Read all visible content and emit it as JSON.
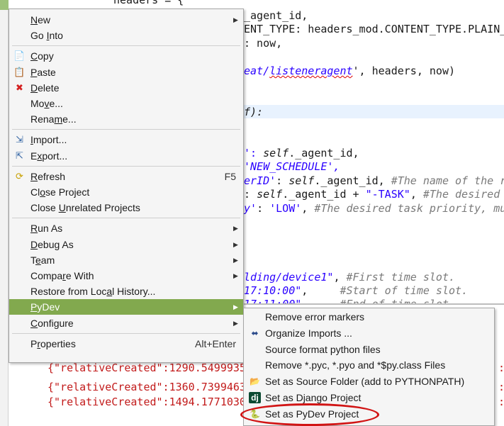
{
  "editor": {
    "top_cut": "headers = {",
    "lines": [
      {
        "parts": [
          {
            "t": "_agent_id,",
            "c": ""
          }
        ]
      },
      {
        "parts": [
          {
            "t": "ENT_TYPE: headers_mod.CONTENT_TYPE.PLAIN_",
            "c": ""
          }
        ]
      },
      {
        "parts": [
          {
            "t": ": now,",
            "c": ""
          }
        ]
      },
      {
        "parts": [
          {
            "t": "",
            "c": ""
          }
        ]
      },
      {
        "parts": [
          {
            "t": "eat/",
            "c": "str ital"
          },
          {
            "t": "listeneragent",
            "c": "str ital squig"
          },
          {
            "t": "', headers, now)",
            "c": ""
          }
        ]
      },
      {
        "parts": [
          {
            "t": "",
            "c": ""
          }
        ]
      },
      {
        "parts": [
          {
            "t": "",
            "c": ""
          }
        ]
      },
      {
        "parts": [
          {
            "t": "f):",
            "c": "ital"
          }
        ]
      },
      {
        "parts": [
          {
            "t": "",
            "c": ""
          }
        ]
      },
      {
        "parts": [
          {
            "t": "",
            "c": ""
          }
        ]
      },
      {
        "parts": [
          {
            "t": "': ",
            "c": "str"
          },
          {
            "t": "self",
            "c": "ital"
          },
          {
            "t": "._agent_id,",
            "c": ""
          }
        ]
      },
      {
        "parts": [
          {
            "t": "'NEW_SCHEDULE',",
            "c": "str ital"
          }
        ]
      },
      {
        "parts": [
          {
            "t": "erID'",
            "c": "str ital"
          },
          {
            "t": ": ",
            "c": ""
          },
          {
            "t": "self",
            "c": "ital"
          },
          {
            "t": "._agent_id, ",
            "c": ""
          },
          {
            "t": "#The name of the r",
            "c": "cmt"
          }
        ]
      },
      {
        "parts": [
          {
            "t": ": ",
            "c": ""
          },
          {
            "t": "self",
            "c": "ital"
          },
          {
            "t": "._agent_id + ",
            "c": ""
          },
          {
            "t": "\"-TASK\"",
            "c": "str"
          },
          {
            "t": ", ",
            "c": ""
          },
          {
            "t": "#The desired",
            "c": "cmt"
          }
        ]
      },
      {
        "parts": [
          {
            "t": "y'",
            "c": "str ital"
          },
          {
            "t": ": ",
            "c": ""
          },
          {
            "t": "'LOW'",
            "c": "str"
          },
          {
            "t": ", ",
            "c": ""
          },
          {
            "t": "#The desired task priority, mu",
            "c": "cmt"
          }
        ]
      },
      {
        "parts": [
          {
            "t": "",
            "c": ""
          }
        ]
      },
      {
        "parts": [
          {
            "t": "",
            "c": ""
          }
        ]
      },
      {
        "parts": [
          {
            "t": "",
            "c": ""
          }
        ]
      },
      {
        "parts": [
          {
            "t": "",
            "c": ""
          }
        ]
      },
      {
        "parts": [
          {
            "t": "lding/device1\"",
            "c": "str ital"
          },
          {
            "t": ", ",
            "c": ""
          },
          {
            "t": "#First time slot.",
            "c": "cmt"
          }
        ]
      },
      {
        "parts": [
          {
            "t": "17:10:00\"",
            "c": "str ital"
          },
          {
            "t": ",     ",
            "c": ""
          },
          {
            "t": "#Start of time slot.",
            "c": "cmt"
          }
        ]
      },
      {
        "parts": [
          {
            "t": "17:11:00\"",
            "c": "str ital"
          },
          {
            "t": ",     ",
            "c": ""
          },
          {
            "t": "#End of time slot",
            "c": "cmt"
          }
        ]
      }
    ]
  },
  "console": {
    "lines": [
      "{\"relativeCreated\":1290.54999351",
      "{\"relativeCreated\":1360.73994636",
      "{\"relativeCreated\":1494.17710304"
    ],
    "right_mark": ":"
  },
  "menu": {
    "items": [
      {
        "label": "New",
        "u": 0,
        "icon": "",
        "icon_name": "",
        "arrow": true
      },
      {
        "label": "Go Into",
        "u": 3,
        "icon": "",
        "icon_name": ""
      },
      {
        "sep": true
      },
      {
        "label": "Copy",
        "u": 0,
        "icon": "📄",
        "icon_name": "copy-icon"
      },
      {
        "label": "Paste",
        "u": 0,
        "icon": "📋",
        "icon_name": "paste-icon"
      },
      {
        "label": "Delete",
        "u": 0,
        "icon": "✖",
        "icon_name": "delete-icon",
        "icon_color": "#d42020"
      },
      {
        "label": "Move...",
        "u": 2,
        "icon": "",
        "icon_name": ""
      },
      {
        "label": "Rename...",
        "u": 4,
        "icon": "",
        "icon_name": ""
      },
      {
        "sep": true
      },
      {
        "label": "Import...",
        "u": 0,
        "icon": "⇲",
        "icon_name": "import-icon",
        "icon_color": "#3465a4"
      },
      {
        "label": "Export...",
        "u": 1,
        "icon": "⇱",
        "icon_name": "export-icon",
        "icon_color": "#3465a4"
      },
      {
        "sep": true
      },
      {
        "label": "Refresh",
        "u": 0,
        "icon": "⟳",
        "icon_name": "refresh-icon",
        "icon_color": "#c8a000",
        "acc": "F5"
      },
      {
        "label": "Close Project",
        "u": 2,
        "icon": "",
        "icon_name": ""
      },
      {
        "label": "Close Unrelated Projects",
        "u": 6,
        "icon": "",
        "icon_name": ""
      },
      {
        "sep": true
      },
      {
        "label": "Run As",
        "u": 0,
        "icon": "",
        "icon_name": "",
        "arrow": true
      },
      {
        "label": "Debug As",
        "u": 0,
        "icon": "",
        "icon_name": "",
        "arrow": true
      },
      {
        "label": "Team",
        "u": 1,
        "icon": "",
        "icon_name": "",
        "arrow": true
      },
      {
        "label": "Compare With",
        "u": 5,
        "icon": "",
        "icon_name": "",
        "arrow": true
      },
      {
        "label": "Restore from Local History...",
        "u": 16,
        "icon": "",
        "icon_name": ""
      },
      {
        "label": "PyDev",
        "u": 0,
        "icon": "",
        "icon_name": "",
        "arrow": true,
        "active": true
      },
      {
        "label": "Configure",
        "u": 0,
        "icon": "",
        "icon_name": "",
        "arrow": true
      },
      {
        "sep": true
      },
      {
        "label": "Properties",
        "u": 1,
        "icon": "",
        "icon_name": "",
        "acc": "Alt+Enter"
      }
    ]
  },
  "submenu": {
    "items": [
      {
        "label": "Remove error markers",
        "icon": "",
        "icon_name": ""
      },
      {
        "label": "Organize Imports ...",
        "icon": "⬌",
        "icon_name": "organize-imports-icon",
        "icon_color": "#2a4a8a"
      },
      {
        "label": "Source format python files",
        "icon": "",
        "icon_name": ""
      },
      {
        "label": "Remove *.pyc, *.pyo and *$py.class Files",
        "icon": "",
        "icon_name": ""
      },
      {
        "label": "Set as Source Folder (add to PYTHONPATH)",
        "icon": "📂",
        "icon_name": "source-folder-icon",
        "icon_color": "#c8961e"
      },
      {
        "label": "Set as Django Project",
        "icon": "dj",
        "icon_name": "django-icon",
        "dj": true
      },
      {
        "label": "Set as PyDev Project",
        "icon": "🐍",
        "icon_name": "pydev-icon",
        "icon_color": "#3a6ea8"
      }
    ]
  },
  "colors": {
    "active_highlight": "#82a94e",
    "annotation_ellipse": "#d11414",
    "console_text": "#c21b1b"
  }
}
